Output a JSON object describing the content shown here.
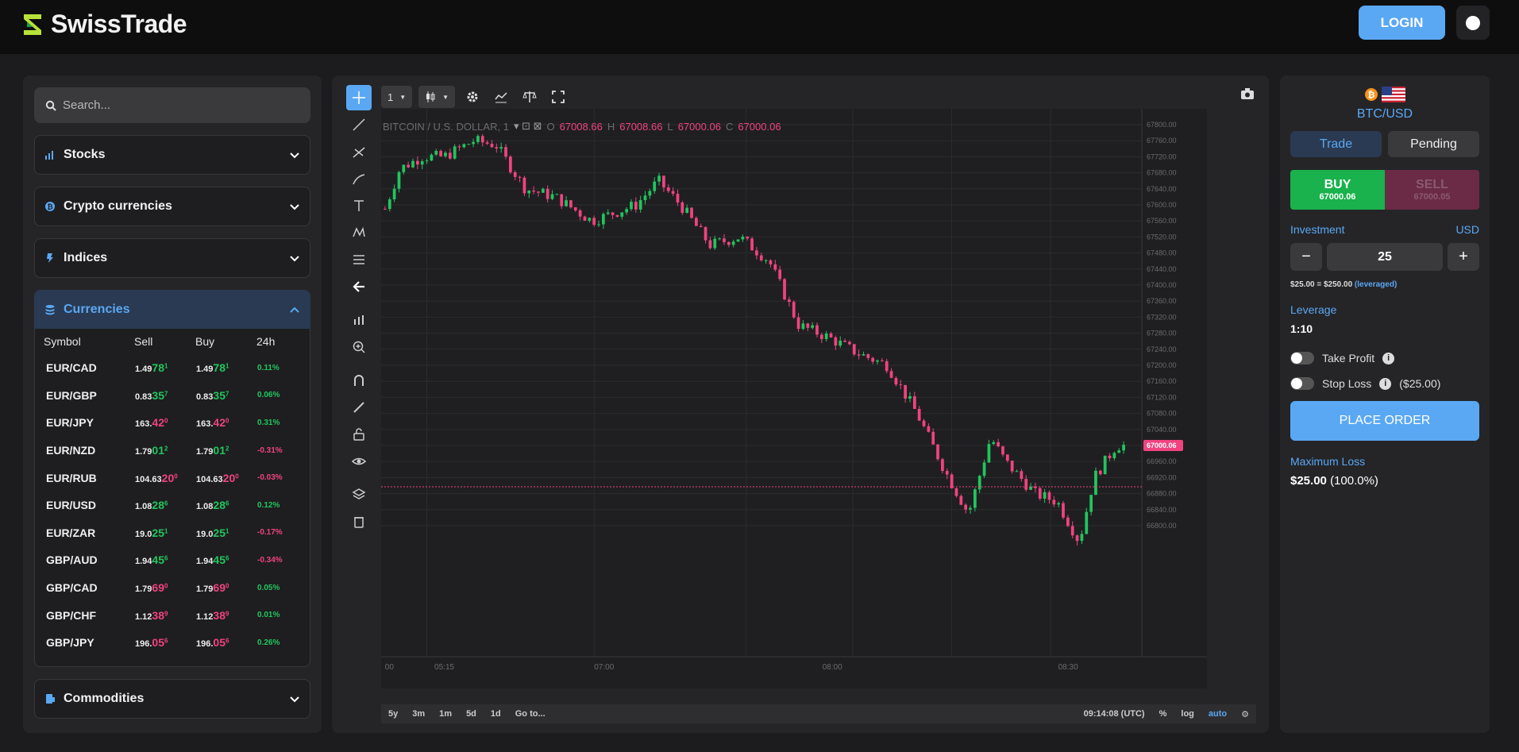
{
  "header": {
    "brand": "SwissTrade",
    "login_label": "LOGIN"
  },
  "sidebar": {
    "search_placeholder": "Search...",
    "categories": [
      {
        "label": "Stocks",
        "icon": "bar-chart-icon"
      },
      {
        "label": "Crypto currencies",
        "icon": "bitcoin-icon"
      },
      {
        "label": "Indices",
        "icon": "index-icon"
      },
      {
        "label": "Currencies",
        "icon": "stack-icon"
      },
      {
        "label": "Commodities",
        "icon": "commodity-icon"
      }
    ],
    "currency_table": {
      "headers": [
        "Symbol",
        "Sell",
        "Buy",
        "24h"
      ],
      "rows": [
        {
          "symbol": "EUR/CAD",
          "sell_pre": "1.49",
          "sell_big": "78",
          "sell_sup": "1",
          "buy_pre": "1.49",
          "buy_big": "78",
          "buy_sup": "1",
          "change": "0.11%",
          "dir": "up"
        },
        {
          "symbol": "EUR/GBP",
          "sell_pre": "0.83",
          "sell_big": "35",
          "sell_sup": "7",
          "buy_pre": "0.83",
          "buy_big": "35",
          "buy_sup": "7",
          "change": "0.06%",
          "dir": "up"
        },
        {
          "symbol": "EUR/JPY",
          "sell_pre": "163.",
          "sell_big": "42",
          "sell_sup": "0",
          "buy_pre": "163.",
          "buy_big": "42",
          "buy_sup": "0",
          "change": "0.31%",
          "dir": "dn"
        },
        {
          "symbol": "EUR/NZD",
          "sell_pre": "1.79",
          "sell_big": "01",
          "sell_sup": "2",
          "buy_pre": "1.79",
          "buy_big": "01",
          "buy_sup": "2",
          "change": "-0.31%",
          "dir": "up"
        },
        {
          "symbol": "EUR/RUB",
          "sell_pre": "104.63",
          "sell_big": "20",
          "sell_sup": "0",
          "buy_pre": "104.63",
          "buy_big": "20",
          "buy_sup": "0",
          "change": "-0.03%",
          "dir": "dn"
        },
        {
          "symbol": "EUR/USD",
          "sell_pre": "1.08",
          "sell_big": "28",
          "sell_sup": "6",
          "buy_pre": "1.08",
          "buy_big": "28",
          "buy_sup": "6",
          "change": "0.12%",
          "dir": "up"
        },
        {
          "symbol": "EUR/ZAR",
          "sell_pre": "19.0",
          "sell_big": "25",
          "sell_sup": "1",
          "buy_pre": "19.0",
          "buy_big": "25",
          "buy_sup": "1",
          "change": "-0.17%",
          "dir": "up"
        },
        {
          "symbol": "GBP/AUD",
          "sell_pre": "1.94",
          "sell_big": "45",
          "sell_sup": "6",
          "buy_pre": "1.94",
          "buy_big": "45",
          "buy_sup": "6",
          "change": "-0.34%",
          "dir": "up"
        },
        {
          "symbol": "GBP/CAD",
          "sell_pre": "1.79",
          "sell_big": "69",
          "sell_sup": "0",
          "buy_pre": "1.79",
          "buy_big": "69",
          "buy_sup": "0",
          "change": "0.05%",
          "dir": "dn"
        },
        {
          "symbol": "GBP/CHF",
          "sell_pre": "1.12",
          "sell_big": "38",
          "sell_sup": "9",
          "buy_pre": "1.12",
          "buy_big": "38",
          "buy_sup": "9",
          "change": "0.01%",
          "dir": "dn"
        },
        {
          "symbol": "GBP/JPY",
          "sell_pre": "196.",
          "sell_big": "05",
          "sell_sup": "6",
          "buy_pre": "196.",
          "buy_big": "05",
          "buy_sup": "6",
          "change": "0.26%",
          "dir": "dn"
        }
      ]
    }
  },
  "chart": {
    "interval": "1",
    "legend": {
      "title": "BITCOIN / U.S. DOLLAR, 1",
      "o": "67008.66",
      "h": "67008.66",
      "l": "67000.06",
      "c": "67000.06"
    },
    "price_ticks": [
      "67800.00",
      "67760.00",
      "67720.00",
      "67680.00",
      "67640.00",
      "67600.00",
      "67560.00",
      "67520.00",
      "67480.00",
      "67440.00",
      "67400.00",
      "67360.00",
      "67320.00",
      "67280.00",
      "67240.00",
      "67200.00",
      "67160.00",
      "67120.00",
      "67080.00",
      "67040.00",
      "67000.00",
      "66960.00",
      "66920.00",
      "66880.00",
      "66840.00",
      "66800.00"
    ],
    "current_price_label": "67000.06",
    "time_labels": [
      "00",
      "05:15",
      "07:00",
      "08:00",
      "08:30"
    ],
    "ranges": [
      "5y",
      "3m",
      "1m",
      "5d",
      "1d"
    ],
    "goto_label": "Go to...",
    "clock": "09:14:08 (UTC)",
    "scale_options": [
      "%",
      "log",
      "auto"
    ]
  },
  "order_panel": {
    "pair": "BTC/USD",
    "tab_trade": "Trade",
    "tab_pending": "Pending",
    "buy_label": "BUY",
    "buy_price": "67000.06",
    "sell_label": "SELL",
    "sell_price": "67000.05",
    "investment_label": "Investment",
    "investment_currency": "USD",
    "investment_value": "25",
    "leverage_note_prefix": "$25.00 = $250.00",
    "leverage_note_suffix": "(leveraged)",
    "leverage_label": "Leverage",
    "leverage_value": "1:10",
    "take_profit_label": "Take Profit",
    "stop_loss_label": "Stop Loss",
    "stop_loss_amount": "($25.00)",
    "place_order_label": "PLACE ORDER",
    "max_loss_label": "Maximum Loss",
    "max_loss_amount": "$25.00",
    "max_loss_pct": "(100.0%)"
  },
  "colors": {
    "accent": "#5aa8f3",
    "up": "#22c55e",
    "down": "#f0437f",
    "buy": "#19b24d",
    "sell": "#6b2a46"
  }
}
